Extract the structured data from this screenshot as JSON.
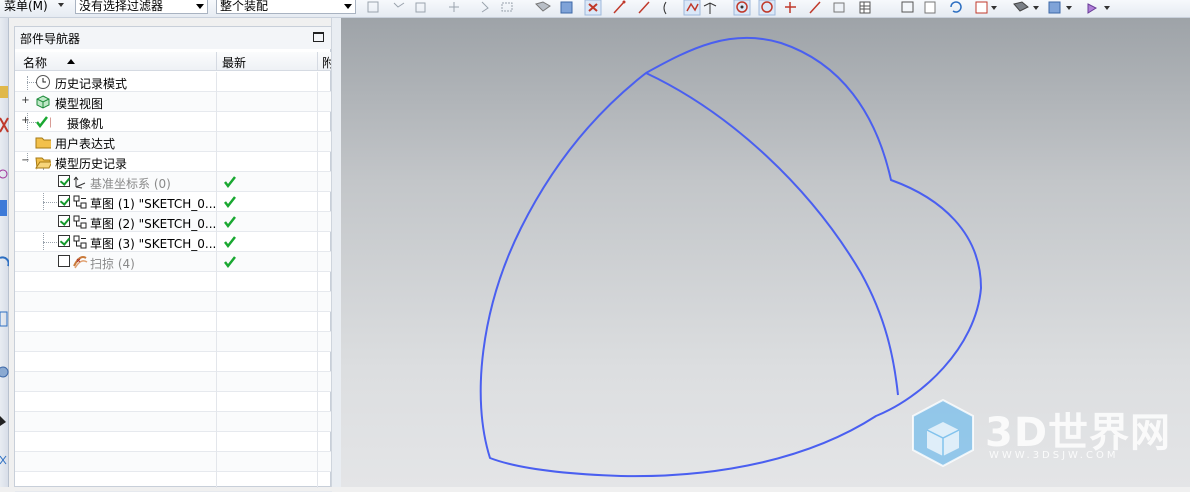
{
  "toolbar": {
    "menu_label": "菜单(M)",
    "filter_value": "没有选择过滤器",
    "scope_value": "整个装配"
  },
  "navigator": {
    "title": "部件导航器",
    "columns": {
      "name": "名称",
      "latest": "最新",
      "extra": "附"
    },
    "nodes": [
      {
        "label": "历史记录模式",
        "icon": "clock-icon"
      },
      {
        "label": "模型视图",
        "icon": "model-views-icon"
      },
      {
        "label": "摄像机",
        "icon": "camera-icon"
      },
      {
        "label": "用户表达式",
        "icon": "folder-icon"
      },
      {
        "label": "模型历史记录",
        "icon": "folder-open-icon"
      },
      {
        "label": "基准坐标系 (0)",
        "icon": "datum-csys-icon",
        "checked": true,
        "latest": true
      },
      {
        "label": "草图 (1) \"SKETCH_0...",
        "icon": "sketch-icon",
        "checked": true,
        "latest": true
      },
      {
        "label": "草图 (2) \"SKETCH_0...",
        "icon": "sketch-icon",
        "checked": true,
        "latest": true
      },
      {
        "label": "草图 (3) \"SKETCH_0...",
        "icon": "sketch-icon",
        "checked": true,
        "latest": true
      },
      {
        "label": "扫掠 (4)",
        "icon": "swept-icon",
        "checked": false,
        "latest": true
      }
    ]
  },
  "colors": {
    "curve": "#4a5ff0",
    "check_green": "#1aa832",
    "graphics_top": "#9ea3a8",
    "graphics_bottom": "#e4e5e7"
  },
  "watermark": {
    "title": "3D世界网",
    "url": "WWW.3DSJW.COM"
  }
}
